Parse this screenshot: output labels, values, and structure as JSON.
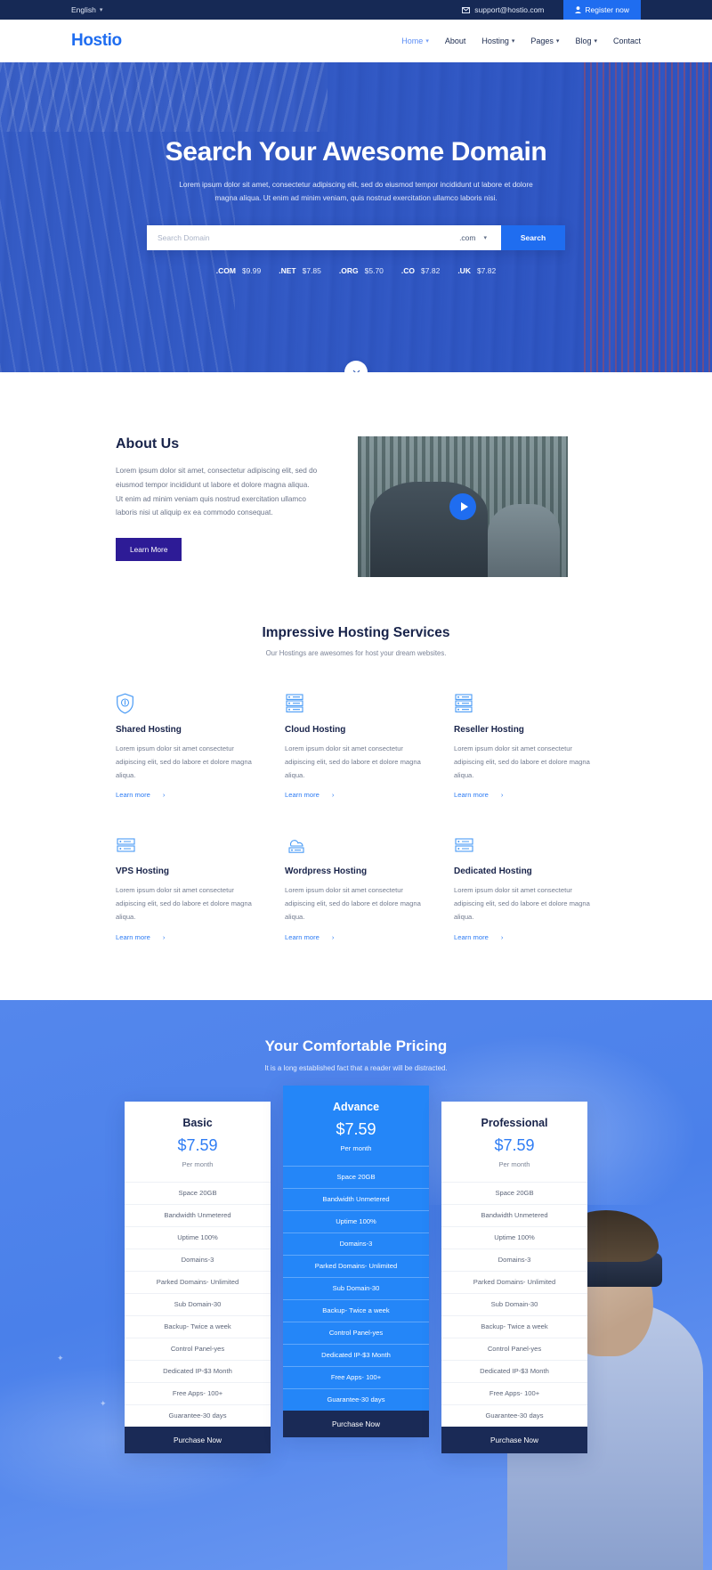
{
  "topbar": {
    "language": "English",
    "email": "support@hostio.com",
    "register_label": "Register now",
    "mail_icon": "mail-icon",
    "user_icon": "user-icon",
    "caret_icon": "chevron-down-icon"
  },
  "nav": {
    "logo": "Hostio",
    "items": [
      {
        "label": "Home",
        "has_caret": true,
        "active": true
      },
      {
        "label": "About",
        "has_caret": false,
        "active": false
      },
      {
        "label": "Hosting",
        "has_caret": true,
        "active": false
      },
      {
        "label": "Pages",
        "has_caret": true,
        "active": false
      },
      {
        "label": "Blog",
        "has_caret": true,
        "active": false
      },
      {
        "label": "Contact",
        "has_caret": false,
        "active": false
      }
    ]
  },
  "hero": {
    "title": "Search Your Awesome Domain",
    "subtitle": "Lorem ipsum dolor sit amet, consectetur adipiscing elit, sed do eiusmod tempor incididunt ut labore et dolore magna aliqua. Ut enim ad minim veniam, quis nostrud exercitation ullamco laboris nisi.",
    "search_placeholder": "Search Domain",
    "search_value": "",
    "tld_selected": ".com",
    "search_button": "Search",
    "scroll_icon": "chevron-down-icon",
    "tlds": [
      {
        "name": ".COM",
        "price": "$9.99"
      },
      {
        "name": ".NET",
        "price": "$7.85"
      },
      {
        "name": ".ORG",
        "price": "$5.70"
      },
      {
        "name": ".CO",
        "price": "$7.82"
      },
      {
        "name": ".UK",
        "price": "$7.82"
      }
    ]
  },
  "about": {
    "title": "About Us",
    "text": "Lorem ipsum dolor sit amet, consectetur adipiscing elit, sed do eiusmod tempor incididunt ut labore et dolore magna aliqua. Ut enim ad minim veniam quis nostrud exercitation ullamco laboris nisi ut aliquip ex ea commodo consequat.",
    "button": "Learn More",
    "play_icon": "play-icon"
  },
  "services": {
    "title": "Impressive Hosting Services",
    "subtitle": "Our Hostings are awesomes for host your dream websites.",
    "link_label": "Learn more",
    "arrow_icon": "chevron-right-icon",
    "items": [
      {
        "name": "Shared Hosting",
        "icon": "shield-hosting-icon",
        "desc": "Lorem ipsum dolor sit amet consectetur adipiscing elit, sed do labore et dolore magna aliqua."
      },
      {
        "name": "Cloud Hosting",
        "icon": "server-rack-icon",
        "desc": "Lorem ipsum dolor sit amet consectetur adipiscing elit, sed do labore et dolore magna aliqua."
      },
      {
        "name": "Reseller Hosting",
        "icon": "server-list-icon",
        "desc": "Lorem ipsum dolor sit amet consectetur adipiscing elit, sed do labore et dolore magna aliqua."
      },
      {
        "name": "VPS Hosting",
        "icon": "server-stack-icon",
        "desc": "Lorem ipsum dolor sit amet consectetur adipiscing elit, sed do labore et dolore magna aliqua."
      },
      {
        "name": "Wordpress Hosting",
        "icon": "cloud-server-icon",
        "desc": "Lorem ipsum dolor sit amet consectetur adipiscing elit, sed do labore et dolore magna aliqua."
      },
      {
        "name": "Dedicated Hosting",
        "icon": "server-grid-icon",
        "desc": "Lorem ipsum dolor sit amet consectetur adipiscing elit, sed do labore et dolore magna aliqua."
      }
    ]
  },
  "pricing": {
    "title": "Your Comfortable Pricing",
    "subtitle": "It is a long established fact that a reader will be distracted.",
    "buy_label": "Purchase Now",
    "features": [
      "Space 20GB",
      "Bandwidth Unmetered",
      "Uptime 100%",
      "Domains-3",
      "Parked Domains- Unlimited",
      "Sub Domain-30",
      "Backup- Twice a week",
      "Control Panel-yes",
      "Dedicated IP-$3 Month",
      "Free Apps- 100+",
      "Guarantee-30 days"
    ],
    "plans": [
      {
        "name": "Basic",
        "price": "$7.59",
        "per": "Per month",
        "featured": false
      },
      {
        "name": "Advance",
        "price": "$7.59",
        "per": "Per month",
        "featured": true
      },
      {
        "name": "Professional",
        "price": "$7.59",
        "per": "Per month",
        "featured": false
      }
    ]
  },
  "colors": {
    "brand_blue": "#1f6df0",
    "dark_navy": "#162955",
    "featured_blue": "#2486f8",
    "purple_button": "#2d1b96"
  }
}
